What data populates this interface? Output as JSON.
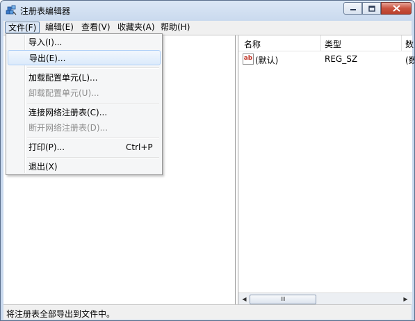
{
  "window": {
    "title": "注册表编辑器"
  },
  "menubar": {
    "items": [
      {
        "label": "文件(F)"
      },
      {
        "label": "编辑(E)"
      },
      {
        "label": "查看(V)"
      },
      {
        "label": "收藏夹(A)"
      },
      {
        "label": "帮助(H)"
      }
    ]
  },
  "file_menu": {
    "items": [
      {
        "label": "导入(I)...",
        "shortcut": "",
        "disabled": false
      },
      {
        "label": "导出(E)...",
        "shortcut": "",
        "disabled": false,
        "highlighted": true
      },
      {
        "label": "加载配置单元(L)...",
        "shortcut": "",
        "disabled": false
      },
      {
        "label": "卸载配置单元(U)...",
        "shortcut": "",
        "disabled": true
      },
      {
        "label": "连接网络注册表(C)...",
        "shortcut": "",
        "disabled": false
      },
      {
        "label": "断开网络注册表(D)...",
        "shortcut": "",
        "disabled": true
      },
      {
        "label": "打印(P)...",
        "shortcut": "Ctrl+P",
        "disabled": false
      },
      {
        "label": "退出(X)",
        "shortcut": "",
        "disabled": false
      }
    ]
  },
  "list": {
    "columns": [
      "名称",
      "类型",
      "数"
    ],
    "rows": [
      {
        "name": "(默认)",
        "type": "REG_SZ",
        "data": "(数"
      }
    ],
    "icon_label": "ab"
  },
  "scrollbar": {
    "left_arrow": "◀",
    "right_arrow": "▶",
    "thumb_grip": "III"
  },
  "statusbar": {
    "text": "将注册表全部导出到文件中。"
  }
}
